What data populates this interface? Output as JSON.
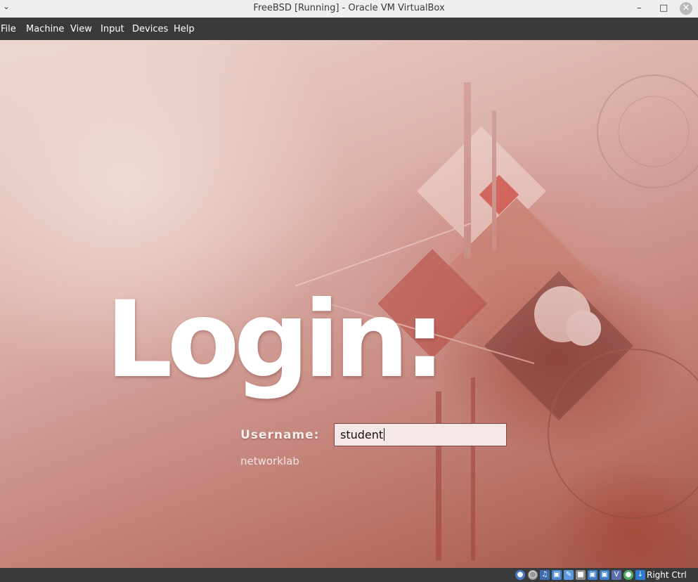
{
  "window": {
    "title": "FreeBSD [Running] - Oracle VM VirtualBox",
    "menu_icon": "chevron-down-icon",
    "controls": [
      "minimize-icon",
      "maximize-icon",
      "close-icon"
    ]
  },
  "menubar": {
    "items": [
      "File",
      "Machine",
      "View",
      "Input",
      "Devices",
      "Help"
    ]
  },
  "guest": {
    "login_title": "Login:",
    "username_label": "Username:",
    "username_value": "student",
    "hostname": "networklab"
  },
  "statusbar": {
    "icons": [
      "hard-disk-icon",
      "optical-drive-icon",
      "audio-icon",
      "network-icon",
      "usb-icon",
      "shared-folders-icon",
      "display-icon",
      "video-capture-icon",
      "virtualization-icon",
      "mouse-integration-icon",
      "host-key-icon"
    ],
    "host_key": "Right Ctrl"
  },
  "colors": {
    "titlebar_bg": "#efefef",
    "menubar_bg": "#3a3a3a",
    "accent_red": "#a0524a"
  }
}
